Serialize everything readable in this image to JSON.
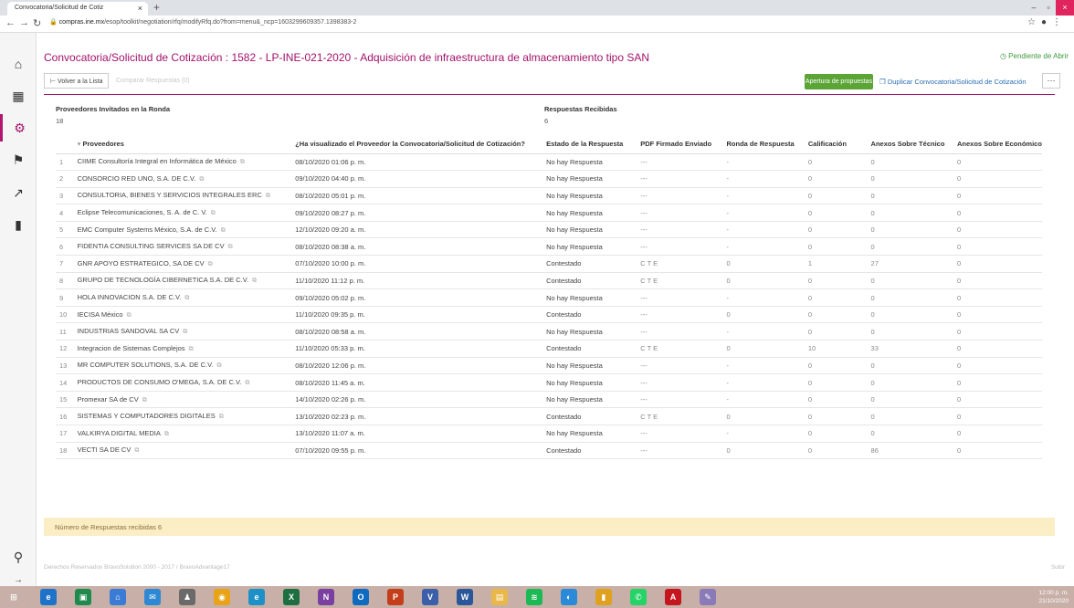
{
  "browser": {
    "tab_title": "Convocatoria/Solicitud de Cotiz",
    "url_host": "compras.ine.mx",
    "url_path": "/esop/toolkit/negotiation/rfq/modifyRfq.do?from=menu&_ncp=1603299609357.1398383-2"
  },
  "header": {
    "title": "Convocatoria/Solicitud de Cotización : 1582 - LP-INE-021-2020 - Adquisición de infraestructura de almacenamiento tipo SAN",
    "status": "Pendiente de Abrir"
  },
  "toolbar": {
    "back_label": "Volver a la Lista",
    "ghost_label": "Comparar Respuestas (0)",
    "apertura_label": "Apertura de propuestas",
    "duplicate_label": "Duplicar Convocatoria/Solicitud de Cotización",
    "more_label": "···"
  },
  "stats": {
    "invited_label": "Proveedores Invitados en la Ronda",
    "invited_value": "18",
    "received_label": "Respuestas Recibidas",
    "received_value": "6"
  },
  "table": {
    "headers": [
      "Proveedores",
      "¿Ha visualizado el Proveedor la Convocatoria/Solicitud de Cotización?",
      "Estado de la Respuesta",
      "PDF Firmado Enviado",
      "Ronda de Respuesta",
      "Calificación",
      "Anexos Sobre Técnico",
      "Anexos Sobre Económico"
    ],
    "rows": [
      {
        "n": "1",
        "name": "CIIME Consultoría Integral en Informática de México",
        "viewed": "08/10/2020 01:06 p. m.",
        "state": "No hay Respuesta",
        "pdf": "---",
        "round": "-",
        "score": "0",
        "tech": "0",
        "econ": "0"
      },
      {
        "n": "2",
        "name": "CONSORCIO RED UNO, S.A. DE C.V.",
        "viewed": "09/10/2020 04:40 p. m.",
        "state": "No hay Respuesta",
        "pdf": "---",
        "round": "-",
        "score": "0",
        "tech": "0",
        "econ": "0"
      },
      {
        "n": "3",
        "name": "CONSULTORIA, BIENES Y SERVICIOS INTEGRALES ERC",
        "viewed": "08/10/2020 05:01 p. m.",
        "state": "No hay Respuesta",
        "pdf": "---",
        "round": "-",
        "score": "0",
        "tech": "0",
        "econ": "0"
      },
      {
        "n": "4",
        "name": "Eclipse Telecomunicaciones, S. A. de C. V.",
        "viewed": "09/10/2020 08:27 p. m.",
        "state": "No hay Respuesta",
        "pdf": "---",
        "round": "-",
        "score": "0",
        "tech": "0",
        "econ": "0"
      },
      {
        "n": "5",
        "name": "EMC Computer Systems México, S.A. de C.V.",
        "viewed": "12/10/2020 09:20 a. m.",
        "state": "No hay Respuesta",
        "pdf": "---",
        "round": "-",
        "score": "0",
        "tech": "0",
        "econ": "0"
      },
      {
        "n": "6",
        "name": "FIDENTIA CONSULTING SERVICES SA DE CV",
        "viewed": "08/10/2020 08:38 a. m.",
        "state": "No hay Respuesta",
        "pdf": "---",
        "round": "-",
        "score": "0",
        "tech": "0",
        "econ": "0"
      },
      {
        "n": "7",
        "name": "GNR APOYO ESTRATEGICO, SA DE CV",
        "viewed": "07/10/2020 10:00 p. m.",
        "state": "Contestado",
        "pdf": "C T E",
        "round": "0",
        "score": "1",
        "tech": "27",
        "econ": "0"
      },
      {
        "n": "8",
        "name": "GRUPO DE TECNOLOGÍA CIBERNETICA S.A. DE C.V.",
        "viewed": "11/10/2020 11:12 p. m.",
        "state": "Contestado",
        "pdf": "C T E",
        "round": "0",
        "score": "0",
        "tech": "0",
        "econ": "0"
      },
      {
        "n": "9",
        "name": "HOLA INNOVACION S.A. DE C.V.",
        "viewed": "09/10/2020 05:02 p. m.",
        "state": "No hay Respuesta",
        "pdf": "---",
        "round": "-",
        "score": "0",
        "tech": "0",
        "econ": "0"
      },
      {
        "n": "10",
        "name": "IECISA México",
        "viewed": "11/10/2020 09:35 p. m.",
        "state": "Contestado",
        "pdf": "---",
        "round": "0",
        "score": "0",
        "tech": "0",
        "econ": "0"
      },
      {
        "n": "11",
        "name": "INDUSTRIAS SANDOVAL SA CV",
        "viewed": "08/10/2020 08:58 a. m.",
        "state": "No hay Respuesta",
        "pdf": "---",
        "round": "-",
        "score": "0",
        "tech": "0",
        "econ": "0"
      },
      {
        "n": "12",
        "name": "Integracion de Sistemas Complejos",
        "viewed": "11/10/2020 05:33 p. m.",
        "state": "Contestado",
        "pdf": "C T E",
        "round": "0",
        "score": "10",
        "tech": "33",
        "econ": "0"
      },
      {
        "n": "13",
        "name": "MR COMPUTER SOLUTIONS, S.A. DE C.V.",
        "viewed": "08/10/2020 12:06 p. m.",
        "state": "No hay Respuesta",
        "pdf": "---",
        "round": "-",
        "score": "0",
        "tech": "0",
        "econ": "0"
      },
      {
        "n": "14",
        "name": "PRODUCTOS DE CONSUMO O'MEGA, S.A. DE C.V.",
        "viewed": "08/10/2020 11:45 a. m.",
        "state": "No hay Respuesta",
        "pdf": "---",
        "round": "-",
        "score": "0",
        "tech": "0",
        "econ": "0"
      },
      {
        "n": "15",
        "name": "Promexar SA de CV",
        "viewed": "14/10/2020 02:26 p. m.",
        "state": "No hay Respuesta",
        "pdf": "---",
        "round": "-",
        "score": "0",
        "tech": "0",
        "econ": "0"
      },
      {
        "n": "16",
        "name": "SISTEMAS Y COMPUTADORES DIGITALES",
        "viewed": "13/10/2020 02:23 p. m.",
        "state": "Contestado",
        "pdf": "C T E",
        "round": "0",
        "score": "0",
        "tech": "0",
        "econ": "0"
      },
      {
        "n": "17",
        "name": "VALKIRYA DIGITAL MEDIA",
        "viewed": "13/10/2020 11:07 a. m.",
        "state": "No hay Respuesta",
        "pdf": "---",
        "round": "-",
        "score": "0",
        "tech": "0",
        "econ": "0"
      },
      {
        "n": "18",
        "name": "VECTI SA DE CV",
        "viewed": "07/10/2020 09:55 p. m.",
        "state": "Contestado",
        "pdf": "---",
        "round": "0",
        "score": "0",
        "tech": "86",
        "econ": "0"
      }
    ]
  },
  "footer": {
    "responses_note": "Número de Respuestas recibidas 6",
    "copyright": "Derechos Reservados BravoSolution 2000 - 2017 / BravoAdvantage17",
    "subir": "Subir"
  },
  "taskbar": {
    "time": "12:00 p. m.",
    "date": "21/10/2020"
  },
  "colors": {
    "brand": "#a2126b",
    "accent_green": "#5ba436",
    "link_blue": "#2a6fb3",
    "note_bg": "#fbeec5"
  }
}
